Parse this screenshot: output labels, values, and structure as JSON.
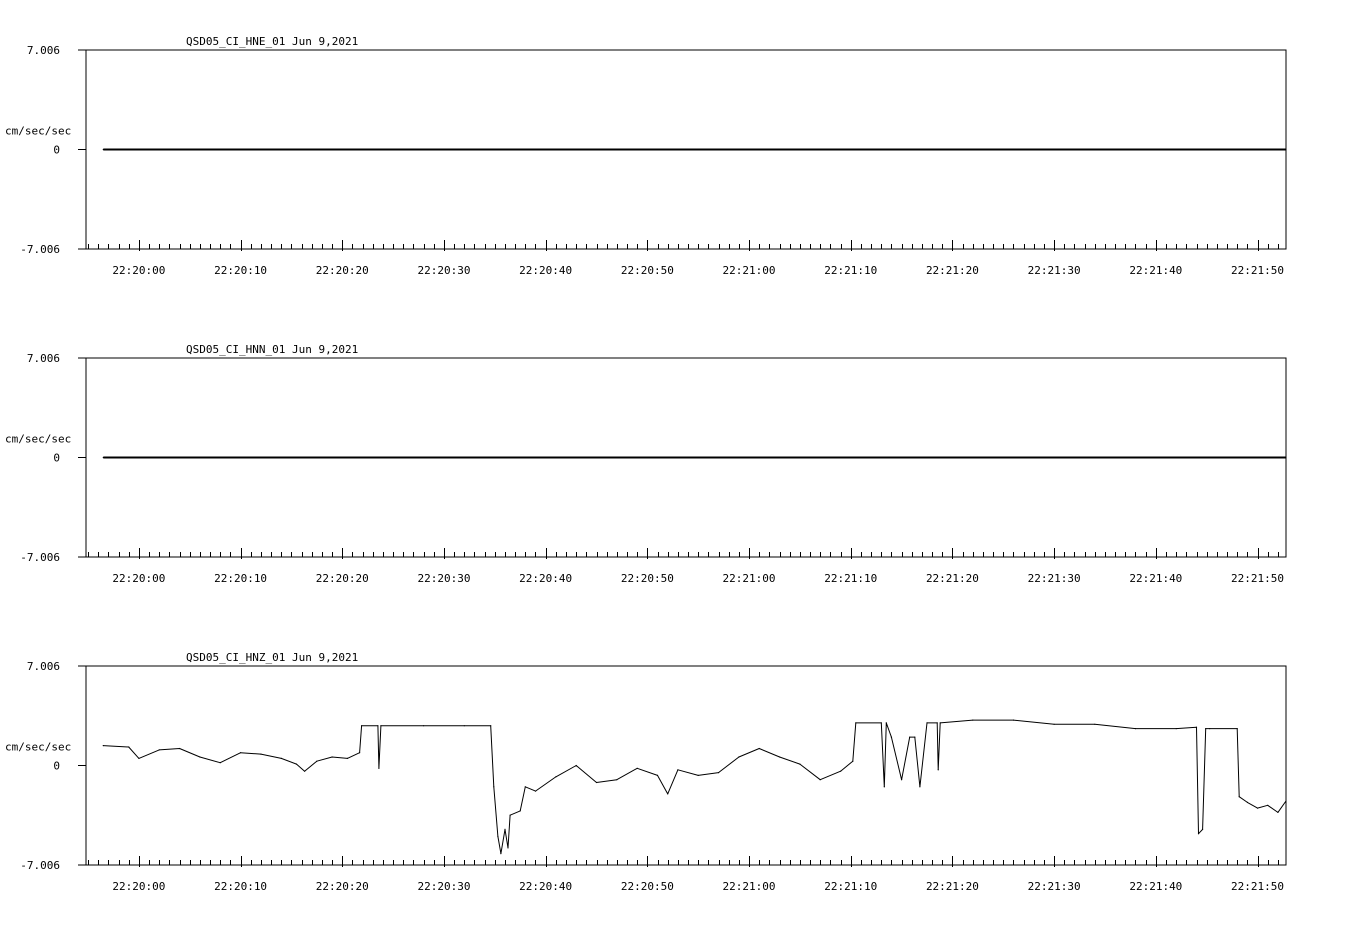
{
  "chart_data": [
    {
      "type": "line",
      "title": "QSD05_CI_HNE_01  Jun 9,2021",
      "ylabel": "cm/sec/sec",
      "ylim": [
        -7.006,
        7.006
      ],
      "y_tick_labels": [
        "7.006",
        "0",
        "-7.006"
      ],
      "xlim": [
        "22:19:54.8",
        "22:21:52.8"
      ],
      "x_tick_labels": [
        "22:20:00",
        "22:20:10",
        "22:20:20",
        "22:20:30",
        "22:20:40",
        "22:20:50",
        "22:21:00",
        "22:21:10",
        "22:21:20",
        "22:21:30",
        "22:21:40",
        "22:21:50"
      ],
      "series": [
        {
          "color": "#000000",
          "x": [
            "22:19:56.5",
            "22:21:52.8"
          ],
          "values": [
            0,
            0
          ]
        }
      ]
    },
    {
      "type": "line",
      "title": "QSD05_CI_HNN_01  Jun 9,2021",
      "ylabel": "cm/sec/sec",
      "ylim": [
        -7.006,
        7.006
      ],
      "y_tick_labels": [
        "7.006",
        "0",
        "-7.006"
      ],
      "xlim": [
        "22:19:54.8",
        "22:21:52.8"
      ],
      "x_tick_labels": [
        "22:20:00",
        "22:20:10",
        "22:20:20",
        "22:20:30",
        "22:20:40",
        "22:20:50",
        "22:21:00",
        "22:21:10",
        "22:21:20",
        "22:21:30",
        "22:21:40",
        "22:21:50"
      ],
      "series": [
        {
          "color": "#000000",
          "x": [
            "22:19:56.5",
            "22:21:52.8"
          ],
          "values": [
            0,
            0
          ]
        }
      ]
    },
    {
      "type": "line",
      "title": "QSD05_CI_HNZ_01  Jun 9,2021",
      "ylabel": "cm/sec/sec",
      "ylim": [
        -7.006,
        7.006
      ],
      "y_tick_labels": [
        "7.006",
        "0",
        "-7.006"
      ],
      "xlim": [
        "22:19:54.8",
        "22:21:52.8"
      ],
      "x_tick_labels": [
        "22:20:00",
        "22:20:10",
        "22:20:20",
        "22:20:30",
        "22:20:40",
        "22:20:50",
        "22:21:00",
        "22:21:10",
        "22:21:20",
        "22:21:30",
        "22:21:40",
        "22:21:50"
      ],
      "series": [
        {
          "color": "#000000",
          "x": [
            "22:19:56.5",
            "22:19:59.0",
            "22:20:00.0",
            "22:20:02.0",
            "22:20:04.0",
            "22:20:06.0",
            "22:20:08.0",
            "22:20:10.0",
            "22:20:12.0",
            "22:20:14.0",
            "22:20:15.5",
            "22:20:16.3",
            "22:20:17.5",
            "22:20:19.0",
            "22:20:20.5",
            "22:20:21.7",
            "22:20:21.9",
            "22:20:23.5",
            "22:20:23.6",
            "22:20:23.8",
            "22:20:28.0",
            "22:20:32.0",
            "22:20:34.6",
            "22:20:34.9",
            "22:20:35.3",
            "22:20:35.6",
            "22:20:36.0",
            "22:20:36.3",
            "22:20:36.5",
            "22:20:37.5",
            "22:20:38.0",
            "22:20:39.0",
            "22:20:41.0",
            "22:20:43.0",
            "22:20:45.0",
            "22:20:47.0",
            "22:20:49.0",
            "22:20:51.0",
            "22:20:52.0",
            "22:20:53.0",
            "22:20:55.0",
            "22:20:57.0",
            "22:20:59.0",
            "22:21:01.0",
            "22:21:03.0",
            "22:21:05.0",
            "22:21:07.0",
            "22:21:09.0",
            "22:21:10.2",
            "22:21:10.5",
            "22:21:13.0",
            "22:21:13.3",
            "22:21:13.5",
            "22:21:14.0",
            "22:21:15.0",
            "22:21:15.8",
            "22:21:16.3",
            "22:21:16.8",
            "22:21:17.5",
            "22:21:18.5",
            "22:21:18.6",
            "22:21:18.8",
            "22:21:22.0",
            "22:21:26.0",
            "22:21:30.0",
            "22:21:34.0",
            "22:21:38.0",
            "22:21:42.0",
            "22:21:44.0",
            "22:21:44.2",
            "22:21:44.6",
            "22:21:44.9",
            "22:21:45.3",
            "22:21:48.0",
            "22:21:48.2",
            "22:21:49.0",
            "22:21:50.0",
            "22:21:51.0",
            "22:21:52.0",
            "22:21:52.8"
          ],
          "values": [
            1.4,
            1.3,
            0.5,
            1.1,
            1.2,
            0.6,
            0.2,
            0.9,
            0.8,
            0.5,
            0.1,
            -0.4,
            0.3,
            0.6,
            0.5,
            0.9,
            2.8,
            2.8,
            -0.2,
            2.8,
            2.8,
            2.8,
            2.8,
            -1.5,
            -5.0,
            -6.2,
            -4.5,
            -5.8,
            -3.5,
            -3.2,
            -1.5,
            -1.8,
            -0.8,
            0.0,
            -1.2,
            -1.0,
            -0.2,
            -0.7,
            -2.0,
            -0.3,
            -0.7,
            -0.5,
            0.6,
            1.2,
            0.6,
            0.1,
            -1.0,
            -0.4,
            0.3,
            3.0,
            3.0,
            -1.5,
            3.0,
            2.0,
            -1.0,
            2.0,
            2.0,
            -1.5,
            3.0,
            3.0,
            -0.3,
            3.0,
            3.2,
            3.2,
            2.9,
            2.9,
            2.6,
            2.6,
            2.7,
            -4.8,
            -4.5,
            2.6,
            2.6,
            2.6,
            -2.2,
            -2.6,
            -3.0,
            -2.8,
            -3.3,
            -2.5
          ]
        }
      ]
    }
  ]
}
